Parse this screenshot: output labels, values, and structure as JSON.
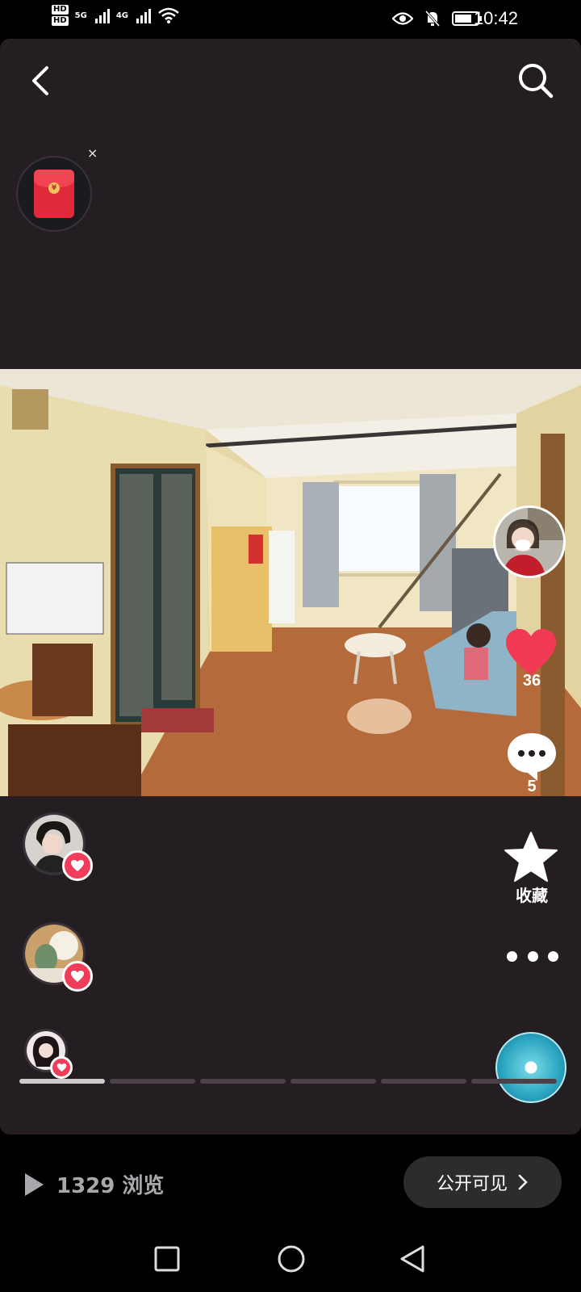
{
  "status_bar": {
    "sim1": "HD",
    "sim2": "HD",
    "net1": "5G",
    "net2": "4G",
    "time": "10:42"
  },
  "red_packet": {
    "close_glyph": "×",
    "icon": "red-envelope-icon"
  },
  "photo": {
    "author_avatar": "woman-with-mask"
  },
  "actions": {
    "like_count": "36",
    "comment_count": "5",
    "favorite_label": "收藏",
    "like_color": "#f23a55"
  },
  "likers": [
    {
      "name": "liker-1"
    },
    {
      "name": "liker-2"
    },
    {
      "name": "liker-3"
    }
  ],
  "progress": {
    "segments": 6,
    "active_index": 0
  },
  "footer": {
    "views_text": "1329 浏览",
    "visibility_label": "公开可见"
  },
  "colors": {
    "background": "#241d22",
    "accent": "#f03e5a",
    "music_disc": "#2aa5c0"
  }
}
